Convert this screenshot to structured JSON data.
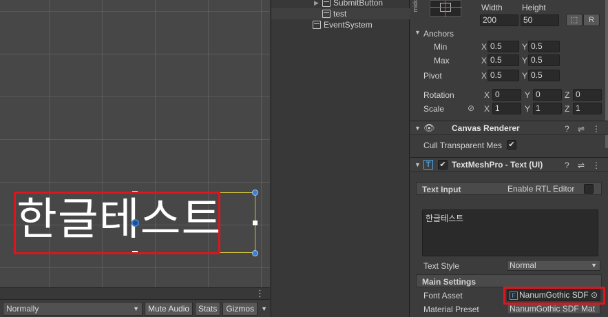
{
  "scene": {
    "text": "한글테스트",
    "toolbar": {
      "dropdown": "Normally",
      "buttons": [
        "Mute Audio",
        "Stats",
        "Gizmos"
      ]
    }
  },
  "hierarchy": {
    "items": [
      {
        "label": "SubmitButton"
      },
      {
        "label": "test"
      },
      {
        "label": "EventSystem"
      }
    ]
  },
  "inspector": {
    "anchor_preset_label": "midd",
    "size": {
      "width_label": "Width",
      "height_label": "Height",
      "width": "200",
      "height": "50",
      "r_button": "R"
    },
    "anchors": {
      "label": "Anchors",
      "min_label": "Min",
      "max_label": "Max",
      "min_x": "0.5",
      "min_y": "0.5",
      "max_x": "0.5",
      "max_y": "0.5"
    },
    "pivot": {
      "label": "Pivot",
      "x": "0.5",
      "y": "0.5"
    },
    "rotation": {
      "label": "Rotation",
      "x": "0",
      "y": "0",
      "z": "0"
    },
    "scale": {
      "label": "Scale",
      "x": "1",
      "y": "1",
      "z": "1"
    },
    "axes": {
      "x": "X",
      "y": "Y",
      "z": "Z"
    },
    "canvas_renderer": {
      "title": "Canvas Renderer",
      "cull_label": "Cull Transparent Mes",
      "cull_checked": true
    },
    "tmp": {
      "title": "TextMeshPro - Text (UI)",
      "icon_letter": "T",
      "text_input_label": "Text Input",
      "rtl_label": "Enable RTL Editor",
      "text_value": "한글테스트",
      "text_style_label": "Text Style",
      "text_style_value": "Normal",
      "main_settings_label": "Main Settings",
      "font_asset_label": "Font Asset",
      "font_asset_value": "NanumGothic SDF",
      "font_icon_letter": "F",
      "material_preset_label": "Material Preset",
      "material_preset_value": "NanumGothic SDF Mat"
    }
  },
  "colors": {
    "highlight": "#e0141e",
    "selection_rect": "#d8c53a",
    "handle": "#3a7fd6"
  }
}
